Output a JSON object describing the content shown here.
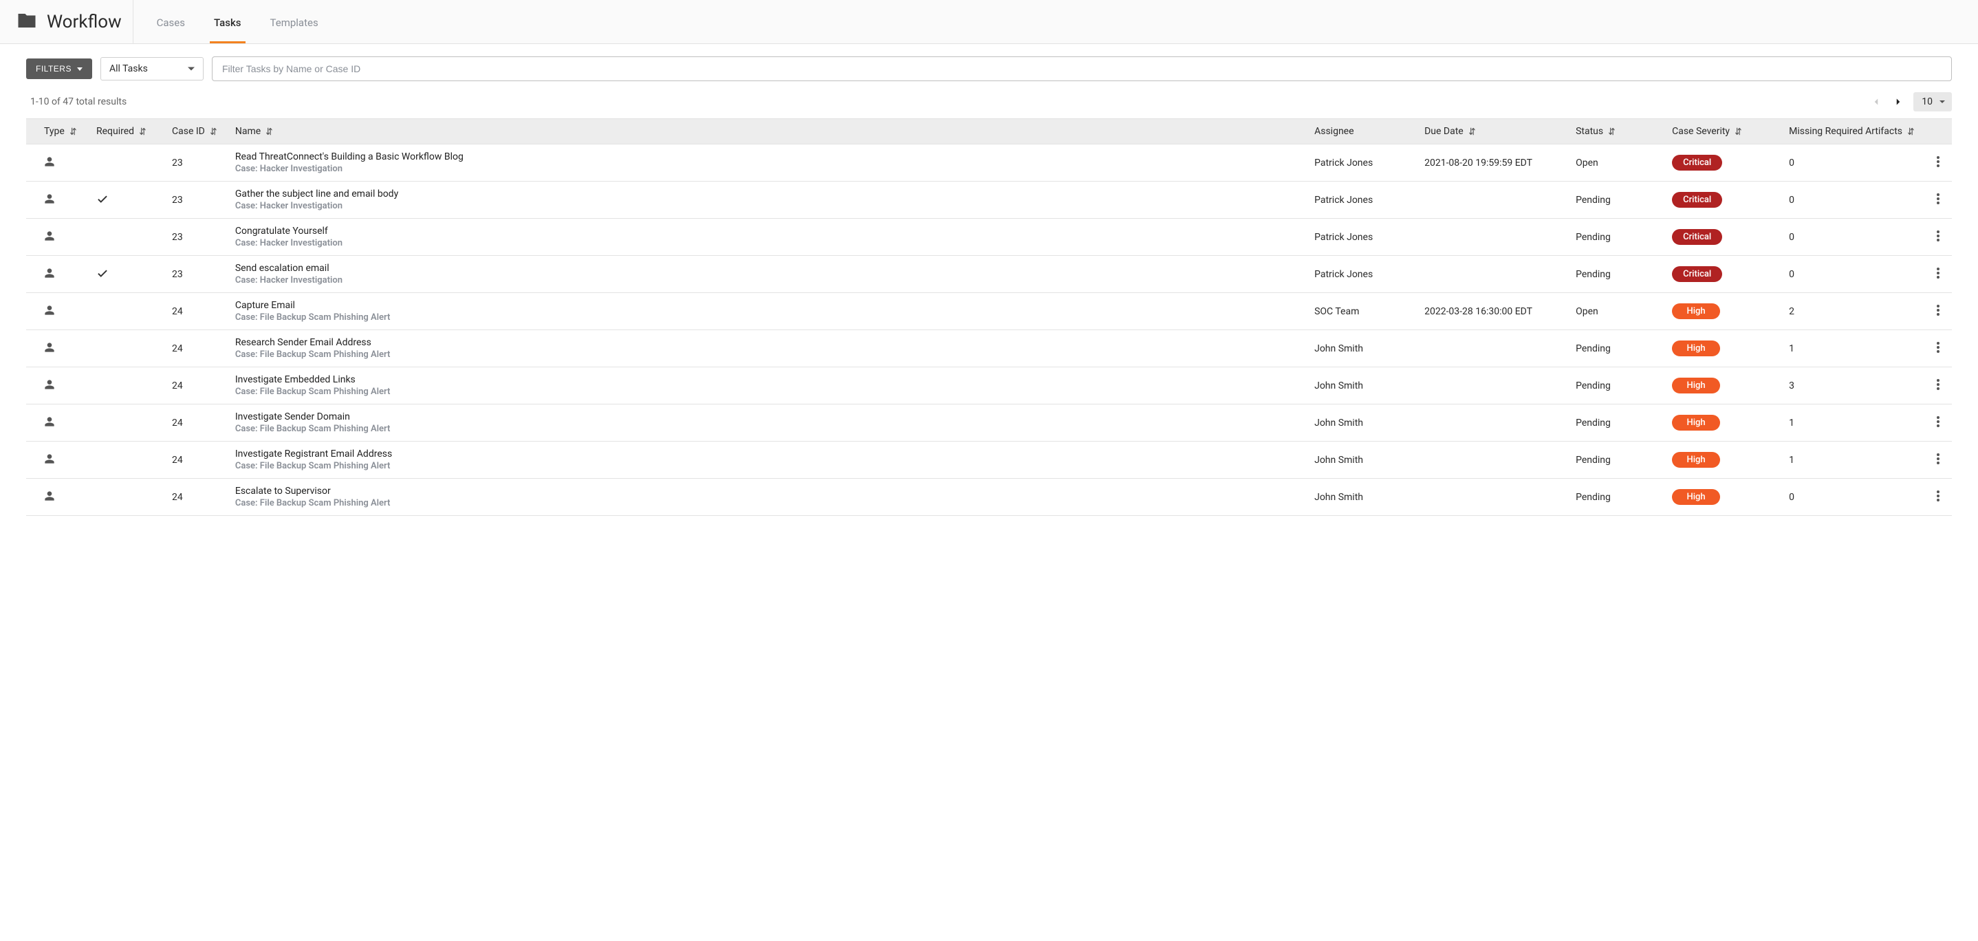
{
  "header": {
    "title": "Workflow",
    "tabs": [
      {
        "label": "Cases",
        "active": false
      },
      {
        "label": "Tasks",
        "active": true
      },
      {
        "label": "Templates",
        "active": false
      }
    ]
  },
  "toolbar": {
    "filters_label": "FILTERS",
    "scope_selected": "All Tasks",
    "search_placeholder": "Filter Tasks by Name or Case ID"
  },
  "pagination": {
    "results_text": "1-10 of 47 total results",
    "page_size": "10",
    "prev_disabled": true,
    "next_disabled": false
  },
  "columns": {
    "type": {
      "label": "Type",
      "sortable": true
    },
    "required": {
      "label": "Required",
      "sortable": true
    },
    "case_id": {
      "label": "Case ID",
      "sortable": true
    },
    "name": {
      "label": "Name",
      "sortable": true
    },
    "assignee": {
      "label": "Assignee",
      "sortable": false
    },
    "due_date": {
      "label": "Due Date",
      "sortable": true
    },
    "status": {
      "label": "Status",
      "sortable": true
    },
    "severity": {
      "label": "Case Severity",
      "sortable": true
    },
    "missing": {
      "label": "Missing Required Artifacts",
      "sortable": true
    }
  },
  "severity_colors": {
    "Critical": "critical",
    "High": "high"
  },
  "rows": [
    {
      "required": false,
      "case_id": "23",
      "name": "Read ThreatConnect's Building a Basic Workflow Blog",
      "case_name": "Case: Hacker Investigation",
      "assignee": "Patrick Jones",
      "due_date": "2021-08-20 19:59:59 EDT",
      "status": "Open",
      "severity": "Critical",
      "missing": "0"
    },
    {
      "required": true,
      "case_id": "23",
      "name": "Gather the subject line and email body",
      "case_name": "Case: Hacker Investigation",
      "assignee": "Patrick Jones",
      "due_date": "",
      "status": "Pending",
      "severity": "Critical",
      "missing": "0"
    },
    {
      "required": false,
      "case_id": "23",
      "name": "Congratulate Yourself",
      "case_name": "Case: Hacker Investigation",
      "assignee": "Patrick Jones",
      "due_date": "",
      "status": "Pending",
      "severity": "Critical",
      "missing": "0"
    },
    {
      "required": true,
      "case_id": "23",
      "name": "Send escalation email",
      "case_name": "Case: Hacker Investigation",
      "assignee": "Patrick Jones",
      "due_date": "",
      "status": "Pending",
      "severity": "Critical",
      "missing": "0"
    },
    {
      "required": false,
      "case_id": "24",
      "name": "Capture Email",
      "case_name": "Case: File Backup Scam Phishing Alert",
      "assignee": "SOC Team",
      "due_date": "2022-03-28 16:30:00 EDT",
      "status": "Open",
      "severity": "High",
      "missing": "2"
    },
    {
      "required": false,
      "case_id": "24",
      "name": "Research Sender Email Address",
      "case_name": "Case: File Backup Scam Phishing Alert",
      "assignee": "John Smith",
      "due_date": "",
      "status": "Pending",
      "severity": "High",
      "missing": "1"
    },
    {
      "required": false,
      "case_id": "24",
      "name": "Investigate Embedded Links",
      "case_name": "Case: File Backup Scam Phishing Alert",
      "assignee": "John Smith",
      "due_date": "",
      "status": "Pending",
      "severity": "High",
      "missing": "3"
    },
    {
      "required": false,
      "case_id": "24",
      "name": "Investigate Sender Domain",
      "case_name": "Case: File Backup Scam Phishing Alert",
      "assignee": "John Smith",
      "due_date": "",
      "status": "Pending",
      "severity": "High",
      "missing": "1"
    },
    {
      "required": false,
      "case_id": "24",
      "name": "Investigate Registrant Email Address",
      "case_name": "Case: File Backup Scam Phishing Alert",
      "assignee": "John Smith",
      "due_date": "",
      "status": "Pending",
      "severity": "High",
      "missing": "1"
    },
    {
      "required": false,
      "case_id": "24",
      "name": "Escalate to Supervisor",
      "case_name": "Case: File Backup Scam Phishing Alert",
      "assignee": "John Smith",
      "due_date": "",
      "status": "Pending",
      "severity": "High",
      "missing": "0"
    }
  ]
}
